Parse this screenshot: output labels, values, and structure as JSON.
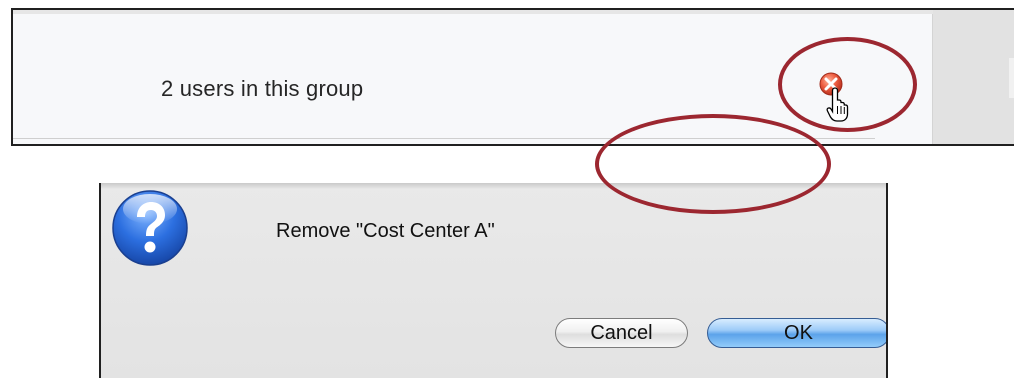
{
  "group_panel": {
    "user_count_text": "2 users in this group",
    "remove_icon": "remove-circle-icon",
    "cursor_icon": "pointing-hand-cursor-icon"
  },
  "dialog": {
    "icon": "question-mark-icon",
    "message": "Remove \"Cost Center A\"",
    "cancel_label": "Cancel",
    "ok_label": "OK"
  },
  "colors": {
    "highlight_ring": "#9c2730",
    "remove_icon": "#e8503a",
    "ok_button": "#5ca3ea",
    "question_icon": "#2c6fe0"
  }
}
